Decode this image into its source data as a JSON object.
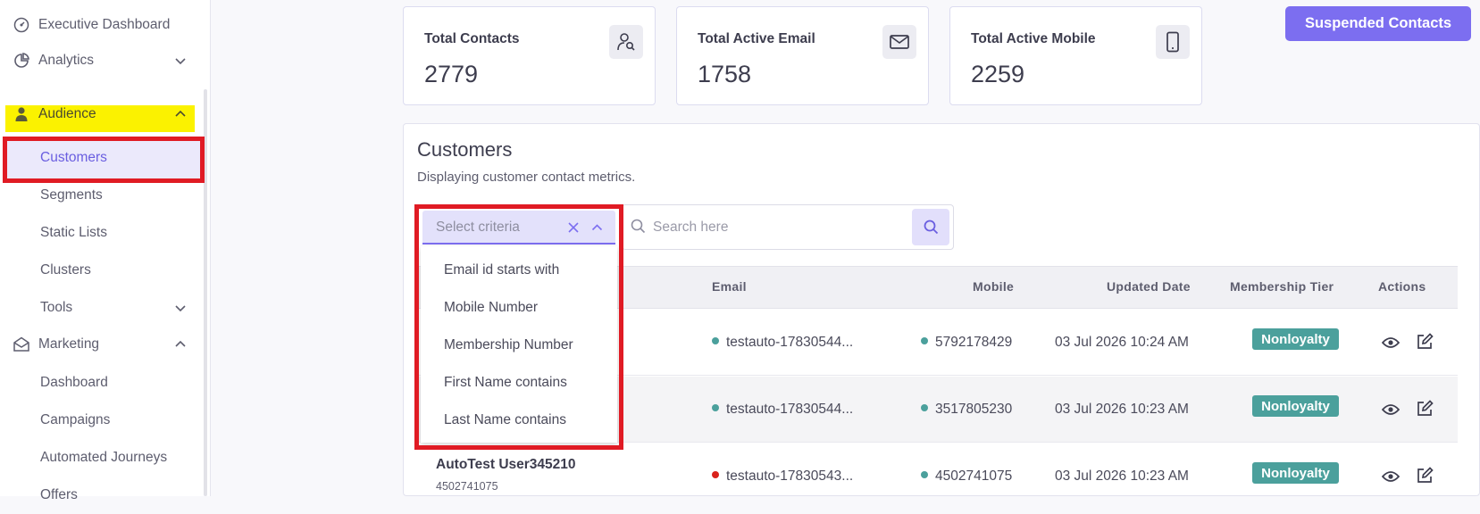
{
  "sidebar": {
    "items": [
      {
        "label": "Executive Dashboard",
        "icon": "gauge-icon"
      },
      {
        "label": "Analytics",
        "icon": "pie-chart-icon"
      },
      {
        "label": "Audience",
        "icon": "user-icon"
      },
      {
        "label": "Marketing",
        "icon": "mail-open-icon"
      }
    ],
    "audience_sub": [
      "Customers",
      "Segments",
      "Static Lists",
      "Clusters",
      "Tools"
    ],
    "marketing_sub": [
      "Dashboard",
      "Campaigns",
      "Automated Journeys",
      "Offers"
    ]
  },
  "stats": [
    {
      "title": "Total Contacts",
      "value": "2779",
      "icon": "user-search-icon"
    },
    {
      "title": "Total Active Email",
      "value": "1758",
      "icon": "envelope-icon"
    },
    {
      "title": "Total Active Mobile",
      "value": "2259",
      "icon": "mobile-phone-icon"
    }
  ],
  "suspended_label": "Suspended Contacts",
  "panel": {
    "title": "Customers",
    "subtitle": "Displaying customer contact metrics."
  },
  "filter": {
    "placeholder": "Select criteria",
    "options": [
      "Email id starts with",
      "Mobile Number",
      "Membership Number",
      "First Name contains",
      "Last Name contains"
    ]
  },
  "search": {
    "placeholder": "Search here"
  },
  "table": {
    "headers": [
      "Email",
      "Mobile",
      "Updated Date",
      "Membership Tier",
      "Actions"
    ],
    "rows": [
      {
        "name": "",
        "sub": "",
        "email": "testauto-17830544...",
        "email_status": "#4ba09c",
        "mobile": "5792178429",
        "mobile_status": "#4ba09c",
        "updated": "03 Jul 2026 10:24 AM",
        "tier": "Nonloyalty"
      },
      {
        "name": "",
        "sub": "",
        "email": "testauto-17830544...",
        "email_status": "#4ba09c",
        "mobile": "3517805230",
        "mobile_status": "#4ba09c",
        "updated": "03 Jul 2026 10:23 AM",
        "tier": "Nonloyalty"
      },
      {
        "name": "AutoTest User345210",
        "sub": "4502741075",
        "email": "testauto-17830543...",
        "email_status": "#d9231c",
        "mobile": "4502741075",
        "mobile_status": "#4ba09c",
        "updated": "03 Jul 2026 10:23 AM",
        "tier": "Nonloyalty"
      }
    ]
  },
  "colors": {
    "accent": "#7c6ef0",
    "highlight": "#fbf200",
    "annotation_red": "#e01b24",
    "badge": "#4ba09c"
  }
}
